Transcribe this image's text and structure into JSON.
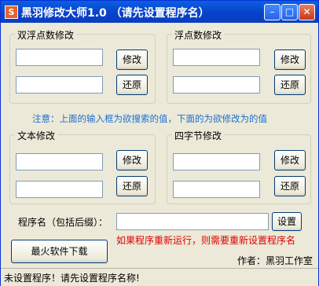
{
  "window": {
    "title_icon": "S",
    "title": "黑羽修改大师1.0  （请先设置程序名）",
    "minimize_glyph": "–",
    "maximize_glyph": "□",
    "close_glyph": "✕"
  },
  "groups": {
    "double_float": {
      "label": "双浮点数修改",
      "modify_label": "修改",
      "restore_label": "还原",
      "search_value": "",
      "modify_value": ""
    },
    "float": {
      "label": "浮点数修改",
      "modify_label": "修改",
      "restore_label": "还原",
      "search_value": "",
      "modify_value": ""
    },
    "text": {
      "label": "文本修改",
      "modify_label": "修改",
      "restore_label": "还原",
      "search_value": "",
      "modify_value": ""
    },
    "four_byte": {
      "label": "四字节修改",
      "modify_label": "修改",
      "restore_label": "还原",
      "search_value": "",
      "modify_value": ""
    }
  },
  "note": "注意：上面的输入框为欲搜索的值，下面的为欲修改为的值",
  "program": {
    "label": "程序名（包括后缀）：",
    "value": "",
    "set_label": "设置",
    "warning": "如果程序重新运行，则需要重新设置程序名"
  },
  "download_label": "最火软件下载",
  "author": "作者：黑羽工作室",
  "status": "未设置程序！请先设置程序名称!"
}
